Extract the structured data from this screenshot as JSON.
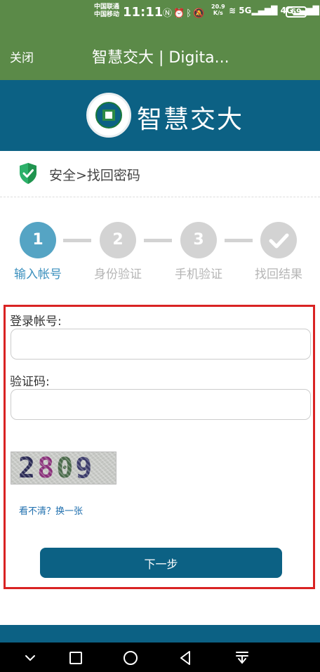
{
  "status": {
    "carrier_line1": "中国联通",
    "carrier_line2": "中国移动",
    "time": "11:11",
    "net_speed_value": "20.9",
    "net_speed_unit": "K/s",
    "battery": "69",
    "icons": [
      "nfc-icon",
      "alarm-icon",
      "bluetooth-icon",
      "mute-icon",
      "wifi-icon",
      "signal-5g-icon",
      "signal-4g-icon"
    ]
  },
  "appbar": {
    "close_label": "关闭",
    "title": "智慧交大 | Digita..."
  },
  "brand": {
    "name": "智慧交大",
    "colors": {
      "header": "#0c6184",
      "appbar": "#5b8a48"
    }
  },
  "breadcrumb": {
    "text": "安全>找回密码"
  },
  "steps": [
    {
      "number": "1",
      "label": "输入帐号",
      "active": true
    },
    {
      "number": "2",
      "label": "身份验证",
      "active": false
    },
    {
      "number": "3",
      "label": "手机验证",
      "active": false
    },
    {
      "number": "",
      "label": "找回结果",
      "active": false
    }
  ],
  "form": {
    "account_label": "登录帐号:",
    "account_value": "",
    "captcha_label": "验证码:",
    "captcha_value": "",
    "captcha_image_text": [
      "2",
      "8",
      "0",
      "9"
    ],
    "refresh_label": "看不清？换一张",
    "next_label": "下一步"
  },
  "navbar": {
    "buttons": [
      "chevron-down-icon",
      "recent-apps-icon",
      "home-icon",
      "back-icon",
      "notification-pull-icon"
    ]
  }
}
